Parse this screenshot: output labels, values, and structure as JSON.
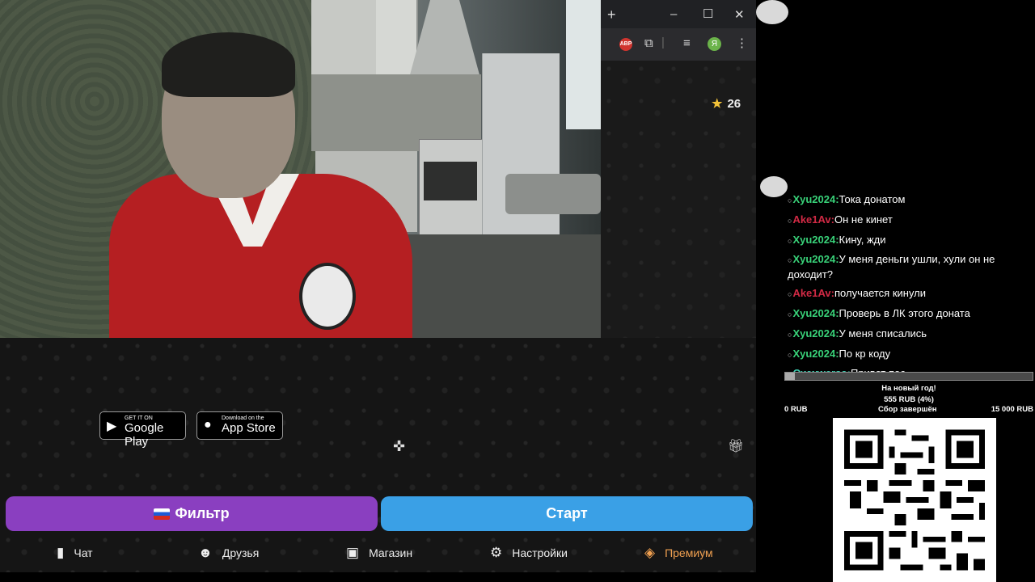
{
  "browser": {
    "new_tab": "+",
    "minimize": "–",
    "maximize": "☐",
    "close": "✕",
    "extension_abp": "ABP",
    "profile_letter": "Я"
  },
  "app": {
    "star_count": "26",
    "store_google": {
      "small": "GET IT ON",
      "big": "Google Play"
    },
    "store_apple": {
      "small": "Download on the",
      "big": "App Store"
    },
    "filter_label": "Фильтр",
    "start_label": "Старт",
    "nav": [
      {
        "label": "Чат",
        "icon": "chat-icon"
      },
      {
        "label": "Друзья",
        "icon": "friends-icon"
      },
      {
        "label": "Магазин",
        "icon": "shop-icon"
      },
      {
        "label": "Настройки",
        "icon": "gear-icon"
      },
      {
        "label": "Премиум",
        "icon": "tag-icon"
      }
    ]
  },
  "chat": [
    {
      "user": "Xyu2024",
      "color": "green",
      "text": "Тока донатом"
    },
    {
      "user": "Ake1Av",
      "color": "red",
      "text": "Он не кинет"
    },
    {
      "user": "Xyu2024",
      "color": "green",
      "text": "Кину, жди"
    },
    {
      "user": "Xyu2024",
      "color": "green",
      "text": "У меня деньги ушли, хули он не доходит?"
    },
    {
      "user": "Ake1Av",
      "color": "red",
      "text": "получается кинули"
    },
    {
      "user": "Xyu2024",
      "color": "green",
      "text": "Проверь в ЛК этого доната"
    },
    {
      "user": "Xyu2024",
      "color": "green",
      "text": "У меня списались"
    },
    {
      "user": "Xyu2024",
      "color": "green",
      "text": "По кр коду"
    },
    {
      "user": "Qwwwersa",
      "color": "teal",
      "text": "Привет пес"
    }
  ],
  "donation": {
    "title": "На новый год!",
    "amount": "555 RUB (4%)",
    "progress_fraction": 0.04,
    "min": "0 RUB",
    "status": "Сбор завершён",
    "max": "15 000 RUB"
  }
}
